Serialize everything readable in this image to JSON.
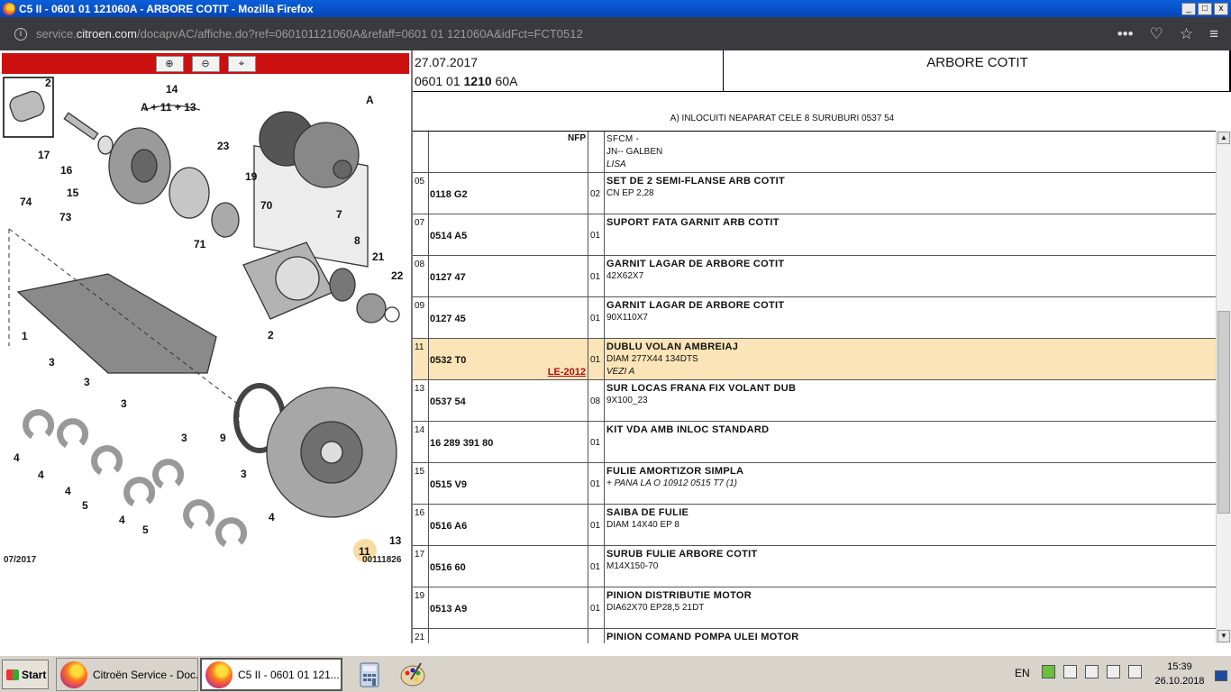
{
  "window": {
    "title": "C5 II - 0601 01 121060A - ARBORE COTIT - Mozilla Firefox",
    "min": "_",
    "max": "□",
    "close": "x"
  },
  "urlbar": {
    "url_pre": "service.",
    "url_domain": "citroen.com",
    "url_post": "/docapvAC/affiche.do?ref=060101121060A&refaff=0601 01 121060A&idFct=FCT0512",
    "info": "i",
    "more": "•••",
    "pocket": "♡",
    "star": "☆",
    "menu": "≡"
  },
  "zoom": {
    "in": "⊕",
    "out": "⊖",
    "fit": "⌖"
  },
  "diagram": {
    "labels": [
      "2",
      "14",
      "A + 11 + 13",
      "A",
      "17",
      "16",
      "15",
      "23",
      "19",
      "74",
      "73",
      "70",
      "7",
      "71",
      "8",
      "21",
      "22",
      "1",
      "2",
      "3",
      "3",
      "3",
      "3",
      "3",
      "4",
      "4",
      "4",
      "4",
      "4",
      "5",
      "5",
      "9",
      "11",
      "13"
    ],
    "date": "07/2017",
    "ref": "00111826"
  },
  "header": {
    "date": "27.07.2017",
    "ref_a": "0601 01 ",
    "ref_b": "1210",
    "ref_c": " 60A",
    "title": "ARBORE COTIT",
    "note": "A) INLOCUITI NEAPARAT CELE 8 SURUBURI 0537 54"
  },
  "rows": [
    {
      "pos": "",
      "code": "",
      "nfp": "NFP",
      "qty": "",
      "desc": "SFCM -",
      "sub": "JN-- GALBEN",
      "sub2": "LISA",
      "link": ""
    },
    {
      "pos": "05",
      "code": "0118 G2",
      "nfp": "",
      "qty": "02",
      "desc": "SET DE 2 SEMI-FLANSE ARB COTIT",
      "sub": "CN EP 2,28",
      "sub2": "",
      "link": ""
    },
    {
      "pos": "07",
      "code": "0514 A5",
      "nfp": "",
      "qty": "01",
      "desc": "SUPORT FATA GARNIT ARB COTIT",
      "sub": "",
      "sub2": "",
      "link": ""
    },
    {
      "pos": "08",
      "code": "0127 47",
      "nfp": "",
      "qty": "01",
      "desc": "GARNIT LAGAR DE ARBORE COTIT",
      "sub": "42X62X7",
      "sub2": "",
      "link": ""
    },
    {
      "pos": "09",
      "code": "0127 45",
      "nfp": "",
      "qty": "01",
      "desc": "GARNIT LAGAR DE ARBORE COTIT",
      "sub": "90X110X7",
      "sub2": "",
      "link": ""
    },
    {
      "pos": "11",
      "code": "0532 T0",
      "nfp": "",
      "qty": "01",
      "desc": "DUBLU VOLAN AMBREIAJ",
      "sub": "DIAM 277X44 134DTS",
      "sub2": "VEZI A",
      "link": "LE-2012"
    },
    {
      "pos": "13",
      "code": "0537 54",
      "nfp": "",
      "qty": "08",
      "desc": "SUR LOCAS FRANA FIX VOLANT DUB",
      "sub": "9X100_23",
      "sub2": "",
      "link": ""
    },
    {
      "pos": "14",
      "code": "16 289 391 80",
      "nfp": "",
      "qty": "01",
      "desc": "KIT VDA AMB INLOC STANDARD",
      "sub": "",
      "sub2": "",
      "link": ""
    },
    {
      "pos": "15",
      "code": "0515 V9",
      "nfp": "",
      "qty": "01",
      "desc": "FULIE AMORTIZOR SIMPLA",
      "sub": "",
      "sub2": "+ PANA LA O 10912 0515 T7 (1)",
      "link": ""
    },
    {
      "pos": "16",
      "code": "0516 A6",
      "nfp": "",
      "qty": "01",
      "desc": "SAIBA DE FULIE",
      "sub": "DIAM 14X40 EP 8",
      "sub2": "",
      "link": ""
    },
    {
      "pos": "17",
      "code": "0516 60",
      "nfp": "",
      "qty": "01",
      "desc": "SURUB FULIE ARBORE COTIT",
      "sub": "M14X150-70",
      "sub2": "",
      "link": ""
    },
    {
      "pos": "19",
      "code": "0513 A9",
      "nfp": "",
      "qty": "01",
      "desc": "PINION DISTRIBUTIE MOTOR",
      "sub": "DIA62X70 EP28,5 21DT",
      "sub2": "",
      "link": ""
    },
    {
      "pos": "21",
      "code": "",
      "nfp": "",
      "qty": "",
      "desc": "PINION COMAND POMPA ULEI MOTOR",
      "sub": "",
      "sub2": "",
      "link": ""
    }
  ],
  "scroll": {
    "up": "▲",
    "down": "▼"
  },
  "taskbar": {
    "start": "Start",
    "task1": "Citroën Service - Doc...",
    "task2": "C5 II - 0601 01 121...",
    "lang": "EN",
    "time": "15:39",
    "date": "26.10.2018"
  },
  "colors": {
    "zoombar": "#cc1010",
    "highlight": "#fbe4b8",
    "link": "#b01010"
  }
}
